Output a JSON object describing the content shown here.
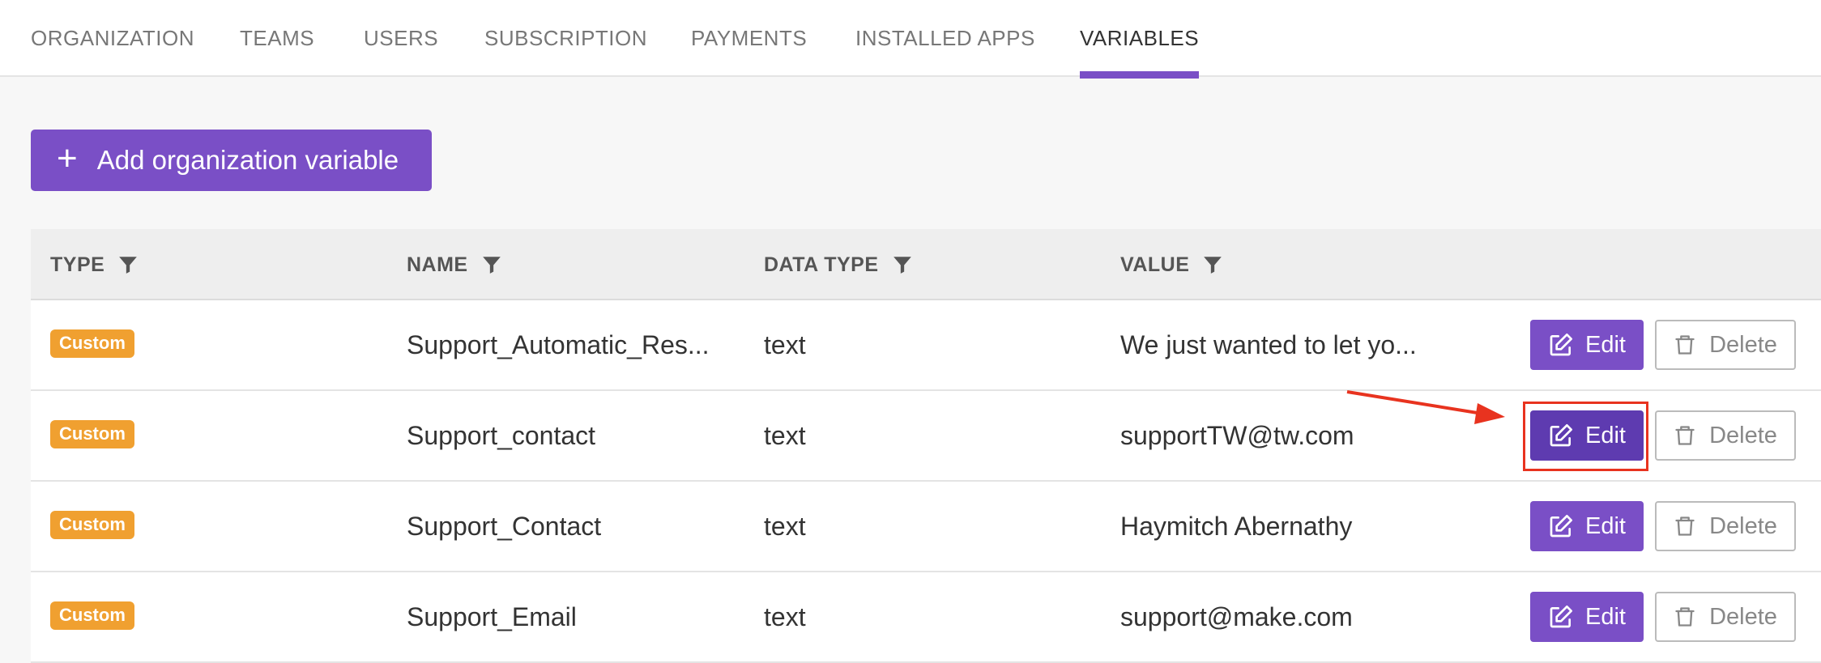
{
  "tabs": [
    {
      "label": "ORGANIZATION",
      "active": false
    },
    {
      "label": "TEAMS",
      "active": false
    },
    {
      "label": "USERS",
      "active": false
    },
    {
      "label": "SUBSCRIPTION",
      "active": false
    },
    {
      "label": "PAYMENTS",
      "active": false
    },
    {
      "label": "INSTALLED APPS",
      "active": false
    },
    {
      "label": "VARIABLES",
      "active": true
    }
  ],
  "add_button": {
    "label": "Add organization variable"
  },
  "table": {
    "headers": [
      "TYPE",
      "NAME",
      "DATA TYPE",
      "VALUE"
    ],
    "rows": [
      {
        "type": "Custom",
        "name": "Support_Automatic_Res...",
        "data_type": "text",
        "value": "We just wanted to let yo...",
        "edit": "Edit",
        "delete": "Delete"
      },
      {
        "type": "Custom",
        "name": "Support_contact",
        "data_type": "text",
        "value": "supportTW@tw.com",
        "edit": "Edit",
        "delete": "Delete"
      },
      {
        "type": "Custom",
        "name": "Support_Contact",
        "data_type": "text",
        "value": "Haymitch Abernathy",
        "edit": "Edit",
        "delete": "Delete"
      },
      {
        "type": "Custom",
        "name": "Support_Email",
        "data_type": "text",
        "value": "support@make.com",
        "edit": "Edit",
        "delete": "Delete"
      }
    ]
  },
  "colors": {
    "accent": "#7a4fc6",
    "badge": "#f0a030",
    "annotation": "#e8331f"
  }
}
